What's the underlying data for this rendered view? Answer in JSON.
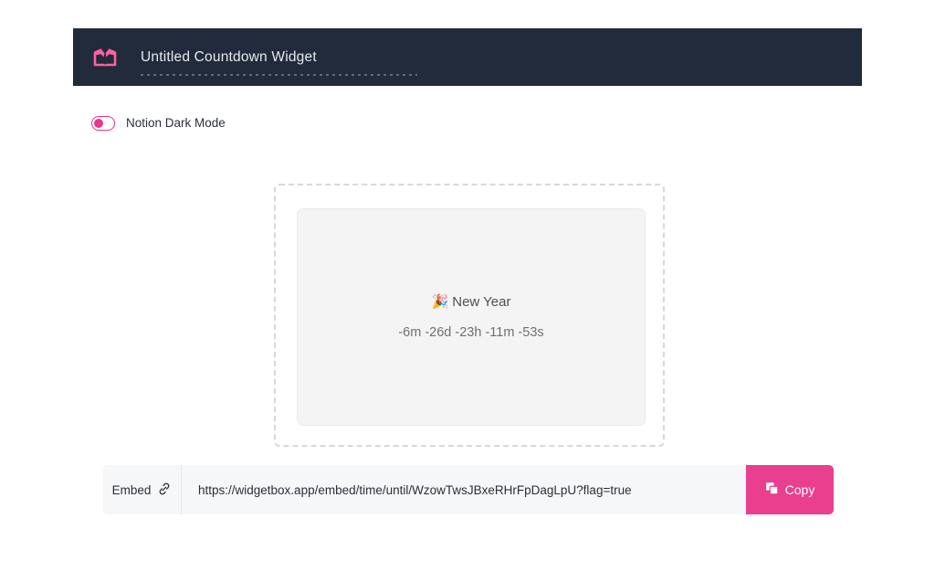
{
  "header": {
    "logo_icon": "open-box-logo-icon",
    "title": "Untitled Countdown Widget",
    "background_color": "#212b3b",
    "brand_color": "#ff5fa2"
  },
  "settings": {
    "dark_mode_toggle": {
      "label": "Notion Dark Mode",
      "state": "off",
      "accent_color": "#e8368f"
    }
  },
  "preview": {
    "widget": {
      "emoji": "🎉",
      "title": "New Year",
      "countdown": "-6m -26d -23h -11m -53s",
      "background_color": "#f4f4f4"
    }
  },
  "embed": {
    "label": "Embed",
    "link_icon": "chain-link-icon",
    "url": "https://widgetbox.app/embed/time/until/WzowTwsJBxeRHrFpDagLpU?flag=true",
    "copy_button": {
      "label": "Copy",
      "icon": "copy-icon",
      "color": "#ea3f8f"
    }
  }
}
